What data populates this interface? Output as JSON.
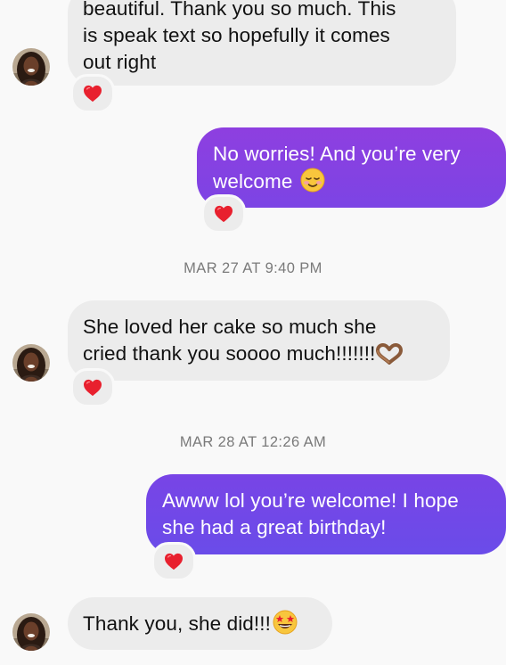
{
  "colors": {
    "background": "#f9f9f9",
    "incoming_bubble": "#ececec",
    "outgoing_gradient_top": "#8e3fe0",
    "outgoing_gradient_bottom": "#6b4be8",
    "heart": "#e8202e",
    "timestamp": "#7a7a7a"
  },
  "messages": [
    {
      "direction": "incoming",
      "lines": [
        "beautiful. Thank you so much. This",
        "is speak text so hopefully it comes",
        "out right"
      ],
      "reaction": "heart-icon"
    },
    {
      "direction": "outgoing",
      "lines": [
        "No worries! And you’re very",
        "welcome"
      ],
      "emoji": "smiling-face-icon",
      "reaction": "heart-icon"
    },
    {
      "direction": "incoming",
      "lines": [
        "She loved her cake so much she",
        "cried thank you soooo much!!!!!!!"
      ],
      "emoji": "heart-hands-icon",
      "reaction": "heart-icon"
    },
    {
      "direction": "outgoing",
      "lines": [
        "Awww lol you’re welcome! I hope",
        "she had a great birthday!"
      ],
      "reaction": "heart-icon"
    },
    {
      "direction": "incoming",
      "lines": [
        "Thank you, she did!!!"
      ],
      "emoji": "star-struck-icon"
    }
  ],
  "timestamps": [
    "MAR 27 AT 9:40 PM",
    "MAR 28 AT 12:26 AM"
  ]
}
